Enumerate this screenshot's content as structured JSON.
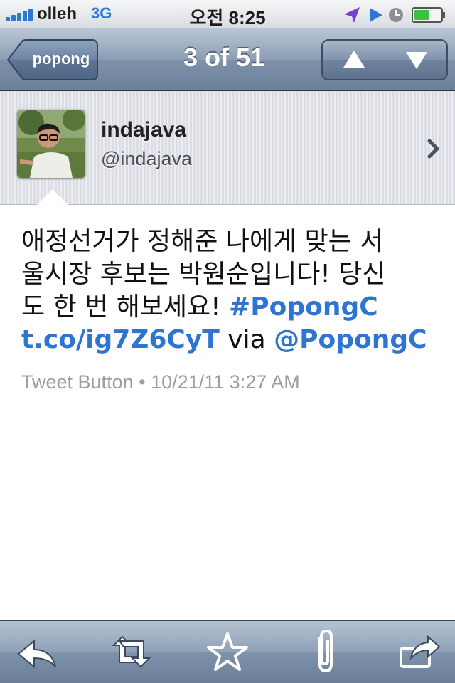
{
  "status_bar": {
    "carrier": "olleh",
    "network": "3G",
    "time": "오전 8:25",
    "icons": [
      "signal-bars-icon",
      "location-icon",
      "play-icon",
      "clock-icon",
      "battery-icon"
    ]
  },
  "nav": {
    "back_label": "popong",
    "title": "3 of 51",
    "up_icon": "arrow-up-icon",
    "down_icon": "arrow-down-icon"
  },
  "user": {
    "display_name": "indajava",
    "handle": "@indajava"
  },
  "tweet": {
    "line1": "애정선거가 정해준 나에게 맞는 서",
    "line2": "울시장 후보는 박원순입니다! 당신",
    "line3_text": "도 한 번 해보세요! ",
    "line3_hashtag": "#PopongC",
    "line4_link": "t.co/ig7Z6CyT",
    "line4_via": " via ",
    "line4_mention": "@PopongC",
    "source": "Tweet Button",
    "separator": " • ",
    "timestamp": "10/21/11 3:27 AM"
  },
  "toolbar": {
    "icons": [
      "reply-icon",
      "retweet-icon",
      "favorite-star-icon",
      "attachment-paperclip-icon",
      "share-icon"
    ]
  },
  "colors": {
    "link": "#2f74d0",
    "nav_bar": "#8c9eb5",
    "status_blue": "#2d78d6"
  }
}
